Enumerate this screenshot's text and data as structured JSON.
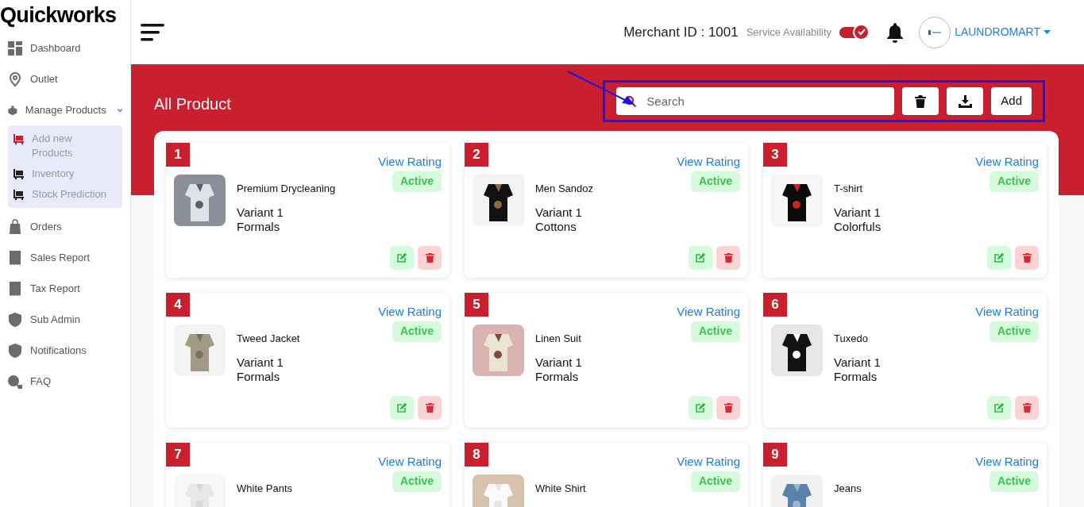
{
  "brand": "Quickworks",
  "sidebar": {
    "items": [
      {
        "label": "Dashboard",
        "kind": "grid"
      },
      {
        "label": "Outlet",
        "kind": "pin"
      },
      {
        "label": "Manage Products",
        "kind": "box",
        "expanded": true,
        "children": [
          {
            "label": "Add new Products",
            "selected": true
          },
          {
            "label": "Inventory",
            "selected": false
          },
          {
            "label": "Stock Prediction",
            "selected": false
          }
        ]
      },
      {
        "label": "Orders",
        "kind": "bag"
      },
      {
        "label": "Sales Report",
        "kind": "receipt"
      },
      {
        "label": "Tax Report",
        "kind": "receipt"
      },
      {
        "label": "Sub Admin",
        "kind": "shield"
      },
      {
        "label": "Notifications",
        "kind": "shield"
      },
      {
        "label": "FAQ",
        "kind": "faq"
      }
    ]
  },
  "header": {
    "merchant_id": "Merchant ID : 1001",
    "service_label": "Service Availability",
    "service_on": true,
    "user": "LAUNDROMART"
  },
  "page": {
    "title": "All Product",
    "search": {
      "placeholder": "Search"
    },
    "add_button": "Add"
  },
  "products": [
    {
      "number": "1",
      "rating_link": "View Rating",
      "name": "Premium Drycleaning",
      "status": "Active",
      "variant": "Variant 1",
      "category": "Formals"
    },
    {
      "number": "2",
      "rating_link": "View Rating",
      "name": "Men Sandoz",
      "status": "Active",
      "variant": "Variant 1",
      "category": "Cottons"
    },
    {
      "number": "3",
      "rating_link": "View Rating",
      "name": "T-shirt",
      "status": "Active",
      "variant": "Variant 1",
      "category": "Colorfuls"
    },
    {
      "number": "4",
      "rating_link": "View Rating",
      "name": "Tweed Jacket",
      "status": "Active",
      "variant": "Variant 1",
      "category": "Formals"
    },
    {
      "number": "5",
      "rating_link": "View Rating",
      "name": "Linen Suit",
      "status": "Active",
      "variant": "Variant 1",
      "category": "Formals"
    },
    {
      "number": "6",
      "rating_link": "View Rating",
      "name": "Tuxedo",
      "status": "Active",
      "variant": "Variant 1",
      "category": "Formals"
    },
    {
      "number": "7",
      "rating_link": "View Rating",
      "name": "White Pants",
      "status": "Active"
    },
    {
      "number": "8",
      "rating_link": "View Rating",
      "name": "White Shirt",
      "status": "Active"
    },
    {
      "number": "9",
      "rating_link": "View Rating",
      "name": "Jeans",
      "status": "Active"
    }
  ]
}
